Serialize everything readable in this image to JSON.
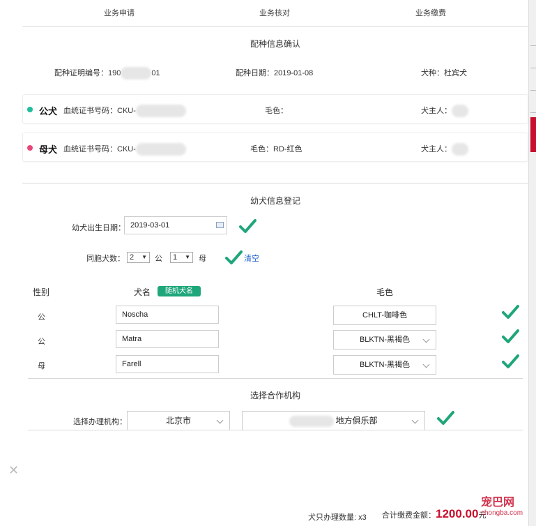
{
  "steps": [
    "业务申请",
    "业务核对",
    "业务缴费"
  ],
  "breeding": {
    "title": "配种信息确认",
    "cert_label": "配种证明编号：",
    "cert_prefix": "190",
    "cert_suffix": "01",
    "date_label": "配种日期：",
    "date_value": "2019-01-08",
    "breed_label": "犬种：",
    "breed_value": "杜宾犬"
  },
  "male": {
    "label": "公犬",
    "pedigree_label": "血统证书号码：",
    "pedigree_prefix": "CKU-",
    "color_label": "毛色：",
    "color_value": "",
    "owner_label": "犬主人："
  },
  "female": {
    "label": "母犬",
    "pedigree_label": "血统证书号码：",
    "pedigree_prefix": "CKU-",
    "color_label": "毛色：",
    "color_value": "RD-红色",
    "owner_label": "犬主人："
  },
  "puppy": {
    "title": "幼犬信息登记",
    "birth_label": "幼犬出生日期：",
    "birth_value": "2019-03-01",
    "litter_label": "同胞犬数：",
    "male_count": "2",
    "male_unit": "公",
    "female_count": "1",
    "female_unit": "母",
    "clear_label": "清空",
    "col_gender": "性别",
    "col_name": "犬名",
    "random_name_btn": "随机犬名",
    "col_color": "毛色",
    "rows": [
      {
        "gender": "公",
        "name": "Noscha",
        "color": "CHLT-咖啡色"
      },
      {
        "gender": "公",
        "name": "Matra",
        "color": "BLKTN-黑褐色"
      },
      {
        "gender": "母",
        "name": "Farell",
        "color": "BLKTN-黑褐色"
      }
    ]
  },
  "org": {
    "title": "选择合作机构",
    "label": "选择办理机构：",
    "city": "北京市",
    "club_suffix": "地方俱乐部"
  },
  "footer": {
    "count_label": "犬只办理数量: x3",
    "total_label": "合计缴费金额：",
    "total_value": "1200.00",
    "total_unit": "元"
  },
  "watermark": {
    "text": "宠巴网",
    "sub": "chongba.com"
  },
  "colors": {
    "accent_green": "#1fa67a",
    "male_dot": "#1fbf9a",
    "female_dot": "#e8477a",
    "amount_red": "#c8102e",
    "link_blue": "#1d5fcf"
  }
}
